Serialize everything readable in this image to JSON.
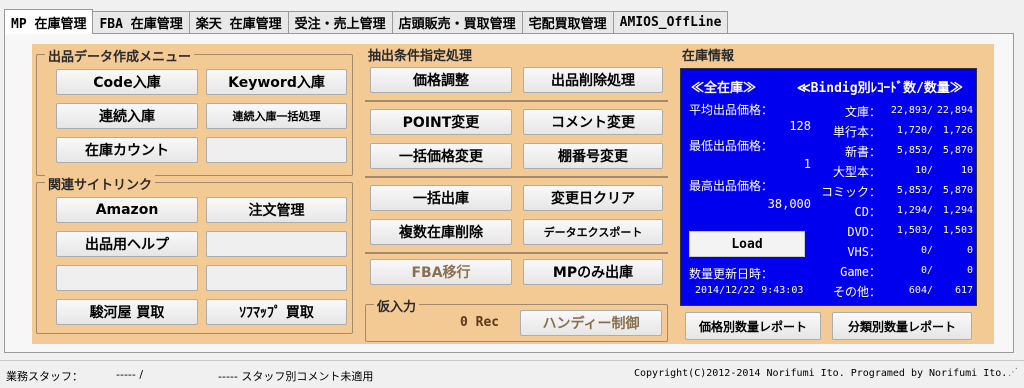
{
  "tabs": [
    "MP 在庫管理",
    "FBA 在庫管理",
    "楽天 在庫管理",
    "受注・売上管理",
    "店頭販売・買取管理",
    "宅配買取管理",
    "AMIOS_OffLine"
  ],
  "listing_menu": {
    "title": "出品データ作成メニュー",
    "code_in": "Code入庫",
    "keyword_in": "Keyword入庫",
    "continuous_in": "連続入庫",
    "continuous_bulk": "連続入庫一括処理",
    "stock_count": "在庫カウント"
  },
  "links": {
    "title": "関連サイトリンク",
    "amazon": "Amazon",
    "orders": "注文管理",
    "help": "出品用ヘルプ",
    "surugaya": "駿河屋 買取",
    "sofmap": "ｿﾌﾏｯﾌﾟ 買取"
  },
  "extraction": {
    "title": "抽出条件指定処理",
    "price_adjust": "価格調整",
    "listing_delete": "出品削除処理",
    "point_change": "POINT変更",
    "comment_change": "コメント変更",
    "bulk_price": "一括価格変更",
    "shelf_change": "棚番号変更",
    "bulk_out": "一括出庫",
    "date_clear": "変更日クリア",
    "multi_delete": "複数在庫削除",
    "data_export": "データエクスポート",
    "fba_move": "FBA移行",
    "mp_out": "MPのみ出庫"
  },
  "temp_input": {
    "title": "仮入力",
    "count": "0 Rec",
    "handy": "ハンディー制御"
  },
  "stock_info": {
    "title": "在庫情報",
    "all_stock": "≪全在庫≫",
    "by_binding": "≪Bindig別ﾚｺｰﾄﾞ数/数量≫",
    "avg_label": "平均出品価格：",
    "avg_value": "128",
    "min_label": "最低出品価格：",
    "min_value": "1",
    "max_label": "最高出品価格：",
    "max_value": "38,000",
    "load": "Load",
    "updated_label": "数量更新日時：",
    "updated_value": "2014/12/22 9:43:03",
    "rows": [
      {
        "label": "文庫：",
        "records": "22,893/",
        "qty": "22,894"
      },
      {
        "label": "単行本：",
        "records": "1,720/",
        "qty": "1,726"
      },
      {
        "label": "新書：",
        "records": "5,853/",
        "qty": "5,870"
      },
      {
        "label": "大型本：",
        "records": "10/",
        "qty": "10"
      },
      {
        "label": "コミック：",
        "records": "5,853/",
        "qty": "5,870"
      },
      {
        "label": "CD：",
        "records": "1,294/",
        "qty": "1,294"
      },
      {
        "label": "DVD：",
        "records": "1,503/",
        "qty": "1,503"
      },
      {
        "label": "VHS：",
        "records": "0/",
        "qty": "0"
      },
      {
        "label": "Game：",
        "records": "0/",
        "qty": "0"
      },
      {
        "label": "その他：",
        "records": "604/",
        "qty": "617"
      }
    ],
    "price_report": "価格別数量レポート",
    "category_report": "分類別数量レポート"
  },
  "status": {
    "staff_label": "業務スタッフ：",
    "staff_value": "-----  /",
    "comment_value": "-----  スタッフ別コメント未適用",
    "copyright": "Copyright(C)2012-2014 Norifumi Ito. Programed by Norifumi Ito."
  },
  "colors": {
    "panel": "#f3c994",
    "stats_bg": "#0000ee"
  }
}
